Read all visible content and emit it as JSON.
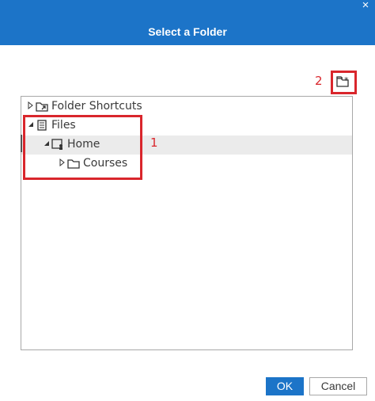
{
  "dialog": {
    "title": "Select a Folder",
    "close_label": "×"
  },
  "toolbar": {
    "new_folder_icon": "new-folder-icon"
  },
  "tree": {
    "items": [
      {
        "label": "Folder Shortcuts",
        "icon": "folder-shortcut-icon",
        "expanded": false,
        "selected": false
      },
      {
        "label": "Files",
        "icon": "files-icon",
        "expanded": true,
        "selected": false
      },
      {
        "label": "Home",
        "icon": "home-folder-icon",
        "expanded": true,
        "selected": true
      },
      {
        "label": "Courses",
        "icon": "folder-icon",
        "expanded": false,
        "selected": false
      }
    ]
  },
  "annotations": {
    "one": "1",
    "two": "2"
  },
  "buttons": {
    "ok": "OK",
    "cancel": "Cancel"
  },
  "colors": {
    "accent": "#1c74c8",
    "annotation": "#d9262c",
    "selected_row": "#ebebeb"
  }
}
